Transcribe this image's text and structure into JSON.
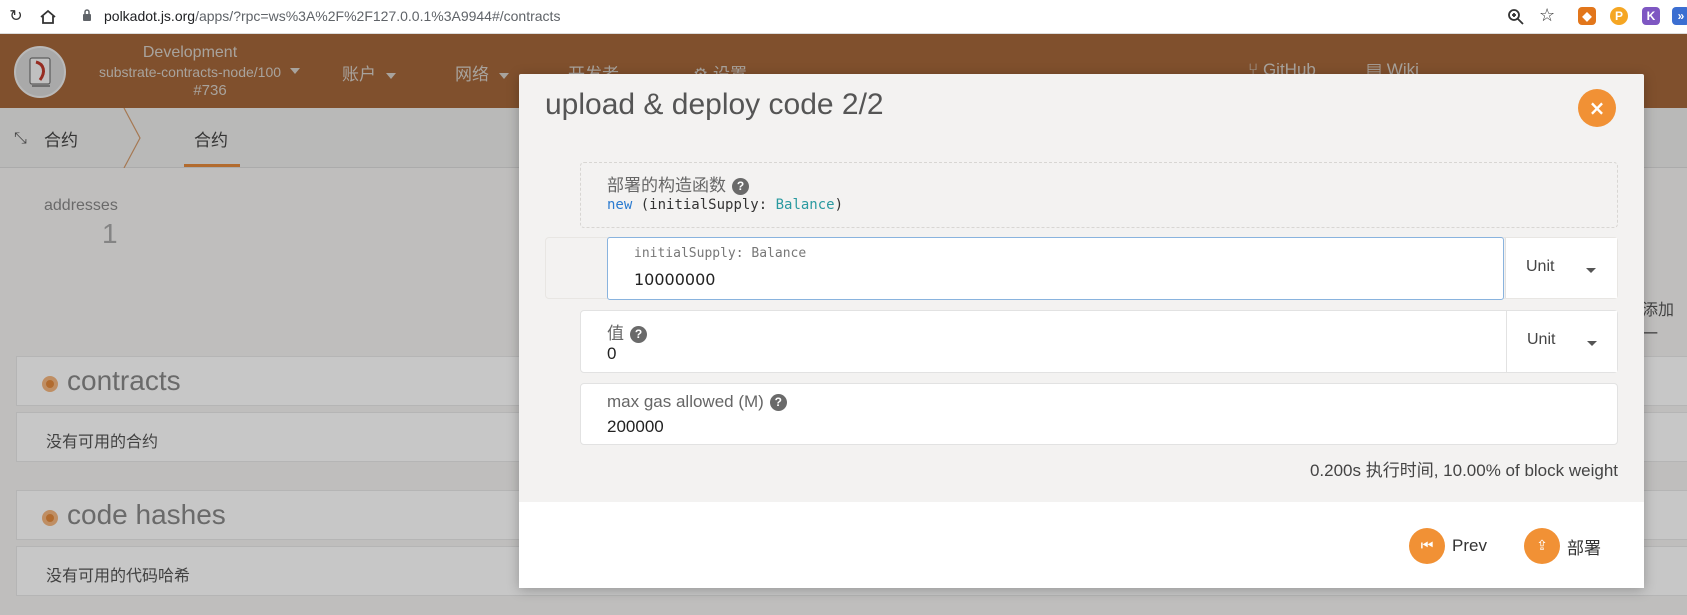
{
  "browser": {
    "url_host": "polkadot.js.org",
    "url_path": "/apps/?rpc=ws%3A%2F%2F127.0.0.1%3A9944#/contracts"
  },
  "header": {
    "chain_line1": "Development",
    "chain_line2": "substrate-contracts-node/100",
    "chain_line3": "#736",
    "menu": [
      "账户",
      "网络",
      "开发者",
      "设置",
      "GitHub",
      "Wiki"
    ]
  },
  "subheader": {
    "crumb": "合约",
    "tab": "合约"
  },
  "summary": {
    "label": "addresses",
    "value": "1"
  },
  "add_text": "添加一",
  "sections": {
    "contracts_title": "contracts",
    "contracts_empty": "没有可用的合约",
    "hashes_title": "code hashes",
    "hashes_empty": "没有可用的代码哈希"
  },
  "modal": {
    "title": "upload & deploy code 2/2",
    "close_icon": "×",
    "constructor_label": "部署的构造函数",
    "ctor_keyword": "new",
    "ctor_open": " (initialSupply: ",
    "ctor_type": "Balance",
    "ctor_close": ")",
    "arg_label": "initialSupply: Balance",
    "arg_value": "10000000",
    "arg_unit": "Unit",
    "value_label": "值",
    "value_value": "0",
    "value_unit": "Unit",
    "gas_label": "max gas allowed (M)",
    "gas_value": "200000",
    "weight_text": "0.200s 执行时间, 10.00% of block weight",
    "prev_label": "Prev",
    "deploy_label": "部署"
  },
  "colors": {
    "header_bg": "#a5673a",
    "accent": "#f19135"
  }
}
